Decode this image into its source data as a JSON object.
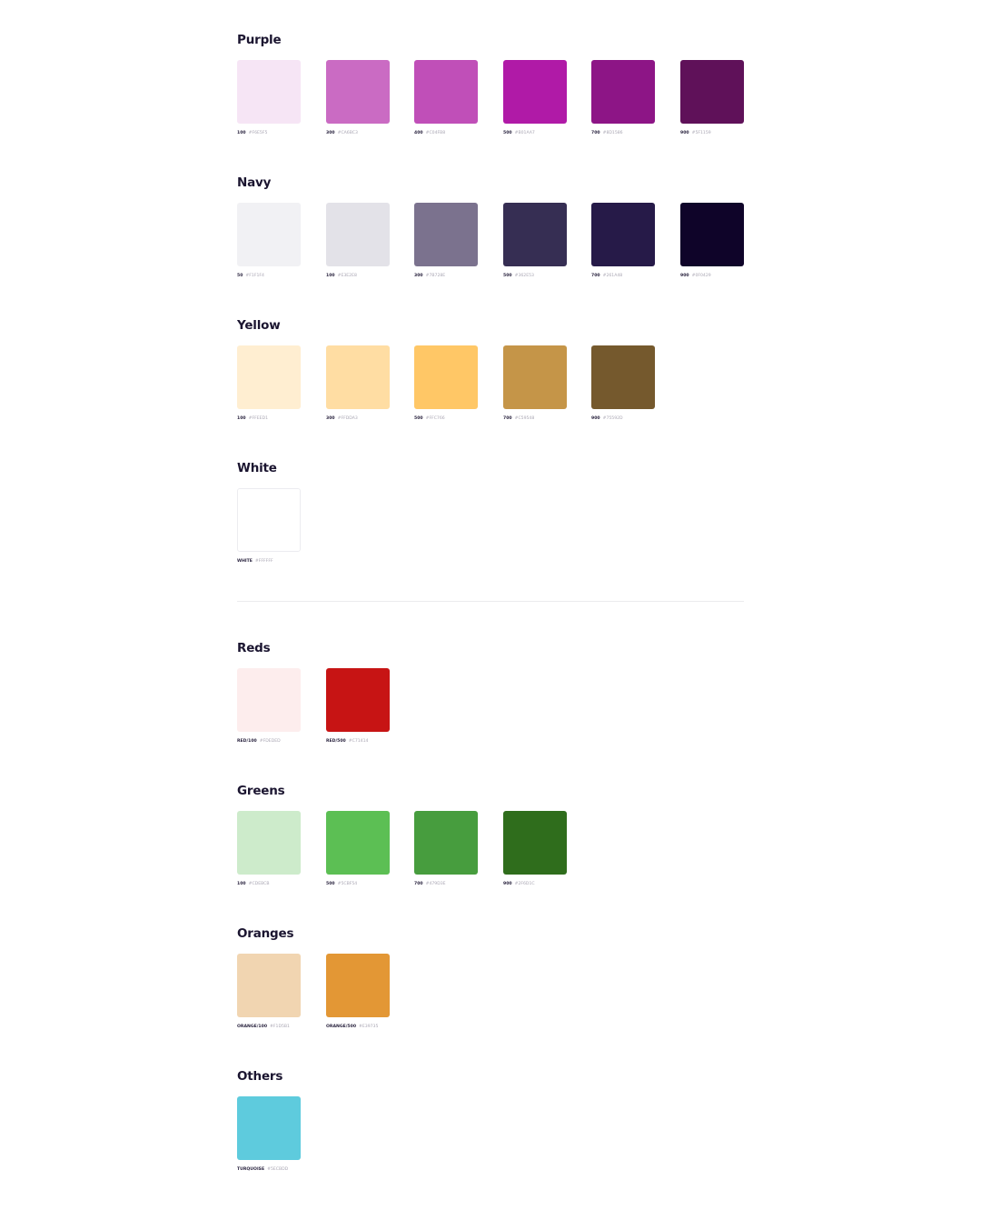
{
  "groups": [
    {
      "title": "Purple",
      "swatches": [
        {
          "name": "100",
          "hex": "#F6E5F5"
        },
        {
          "name": "300",
          "hex": "#CA6BC3"
        },
        {
          "name": "400",
          "hex": "#C04FB8"
        },
        {
          "name": "500",
          "hex": "#B01AA7"
        },
        {
          "name": "700",
          "hex": "#8D1586"
        },
        {
          "name": "900",
          "hex": "#5F1159"
        }
      ]
    },
    {
      "title": "Navy",
      "swatches": [
        {
          "name": "50",
          "hex": "#F1F1F4"
        },
        {
          "name": "100",
          "hex": "#E3E2E8"
        },
        {
          "name": "300",
          "hex": "#7B728E"
        },
        {
          "name": "500",
          "hex": "#362E53"
        },
        {
          "name": "700",
          "hex": "#261A48"
        },
        {
          "name": "900",
          "hex": "#0F0429"
        }
      ]
    },
    {
      "title": "Yellow",
      "swatches": [
        {
          "name": "100",
          "hex": "#FFEED1"
        },
        {
          "name": "300",
          "hex": "#FFDDA3"
        },
        {
          "name": "500",
          "hex": "#FFC766"
        },
        {
          "name": "700",
          "hex": "#C59548"
        },
        {
          "name": "900",
          "hex": "#75592D"
        }
      ]
    },
    {
      "title": "White",
      "swatches": [
        {
          "name": "WHITE",
          "hex": "#FFFFFF"
        }
      ]
    },
    {
      "title": "Reds",
      "swatches": [
        {
          "name": "RED/100",
          "hex": "#FDEDED"
        },
        {
          "name": "RED/500",
          "hex": "#C71414"
        }
      ]
    },
    {
      "title": "Greens",
      "swatches": [
        {
          "name": "100",
          "hex": "#CDEBCB"
        },
        {
          "name": "500",
          "hex": "#5CBF54"
        },
        {
          "name": "700",
          "hex": "#479D3E"
        },
        {
          "name": "900",
          "hex": "#2F6D1C"
        }
      ]
    },
    {
      "title": "Oranges",
      "swatches": [
        {
          "name": "ORANGE/100",
          "hex": "#F1D5B1"
        },
        {
          "name": "ORANGE/500",
          "hex": "#E39735"
        }
      ]
    },
    {
      "title": "Others",
      "swatches": [
        {
          "name": "TURQUOISE",
          "hex": "#5ECBDD"
        }
      ]
    }
  ]
}
